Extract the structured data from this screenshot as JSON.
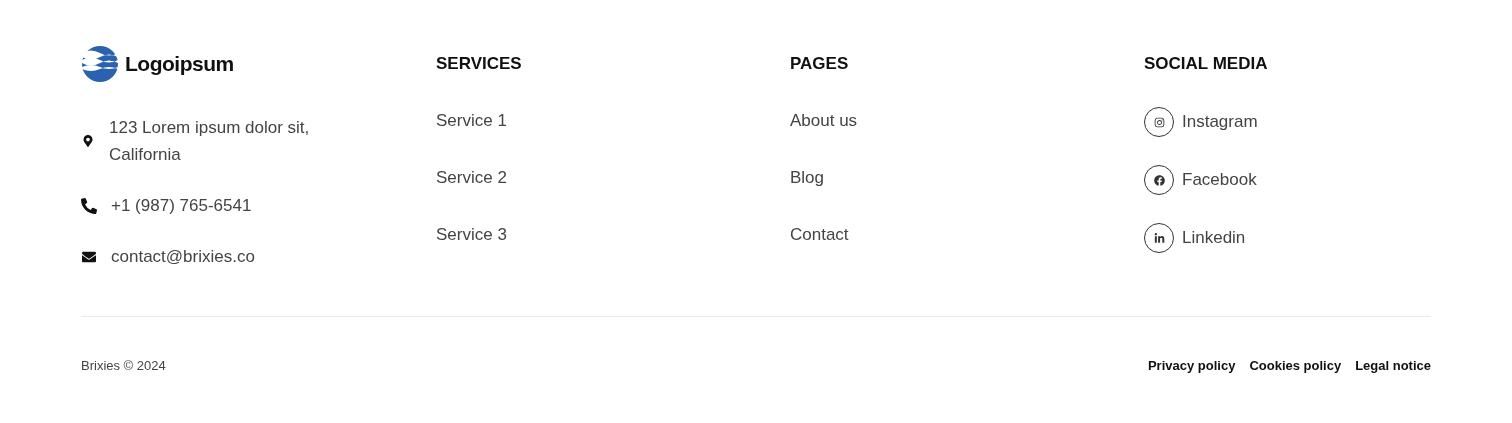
{
  "brand": {
    "name": "Logoipsum"
  },
  "contacts": [
    {
      "kind": "location",
      "text": "123 Lorem ipsum dolor sit, California"
    },
    {
      "kind": "phone",
      "text": "+1 (987) 765-6541"
    },
    {
      "kind": "email",
      "text": "contact@brixies.co"
    }
  ],
  "columns": [
    {
      "heading": "SERVICES",
      "links": [
        "Service 1",
        "Service 2",
        "Service 3"
      ]
    },
    {
      "heading": "PAGES",
      "links": [
        "About us",
        "Blog",
        "Contact"
      ]
    }
  ],
  "social": {
    "heading": "SOCIAL MEDIA",
    "items": [
      {
        "kind": "instagram",
        "label": "Instagram"
      },
      {
        "kind": "facebook",
        "label": "Facebook"
      },
      {
        "kind": "linkedin",
        "label": "Linkedin"
      }
    ]
  },
  "bottom": {
    "copyright": "Brixies © 2024",
    "links": [
      "Privacy policy",
      "Cookies policy",
      "Legal notice"
    ]
  }
}
